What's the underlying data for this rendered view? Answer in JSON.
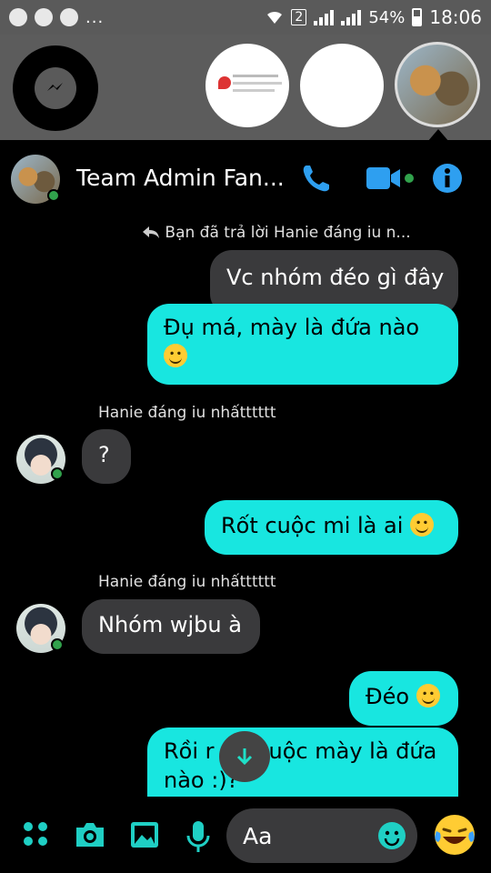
{
  "status_bar": {
    "battery": "54%",
    "time": "18:06",
    "sim_slot": "2",
    "overflow": "..."
  },
  "chat": {
    "title": "Team Admin Fan...",
    "reply_note": "Bạn đã trả lời Hanie đáng iu n...",
    "messages": [
      {
        "text": "Vc nhóm đéo gì đây",
        "side": "right",
        "style": "gray"
      },
      {
        "text": "Đụ má, mày là đứa nào",
        "side": "right",
        "style": "cyan",
        "emoji": "slightly-smiling-face"
      },
      {
        "sender": "Hanie đáng iu nhấtttttt",
        "text": "?",
        "side": "left"
      },
      {
        "text": "Rốt cuộc mi là ai",
        "side": "right",
        "style": "cyan",
        "emoji": "slightly-smiling-face"
      },
      {
        "sender": "Hanie đáng iu nhấtttttt",
        "text": "Nhóm wjbu à",
        "side": "left"
      },
      {
        "text": "Đéo",
        "side": "right",
        "style": "cyan",
        "emoji": "slightly-smiling-face"
      },
      {
        "text": "Rồi r",
        "text_cont": "uộc mày là đứa",
        "text_line2": "nào :)?",
        "side": "right",
        "style": "cyan"
      }
    ]
  },
  "composer": {
    "placeholder": "Aa"
  },
  "colors": {
    "accent": "#2e9ff0",
    "bubble_cyan": "#18e6e0",
    "bubble_gray": "#3a3a3c",
    "online": "#31a24c"
  },
  "icons": [
    "messenger-icon",
    "phone-icon",
    "video-icon",
    "info-icon",
    "reply-arrow-icon",
    "apps-icon",
    "camera-icon",
    "gallery-icon",
    "mic-icon",
    "emoji-icon",
    "laughing-emoji-icon",
    "arrow-down-icon"
  ]
}
